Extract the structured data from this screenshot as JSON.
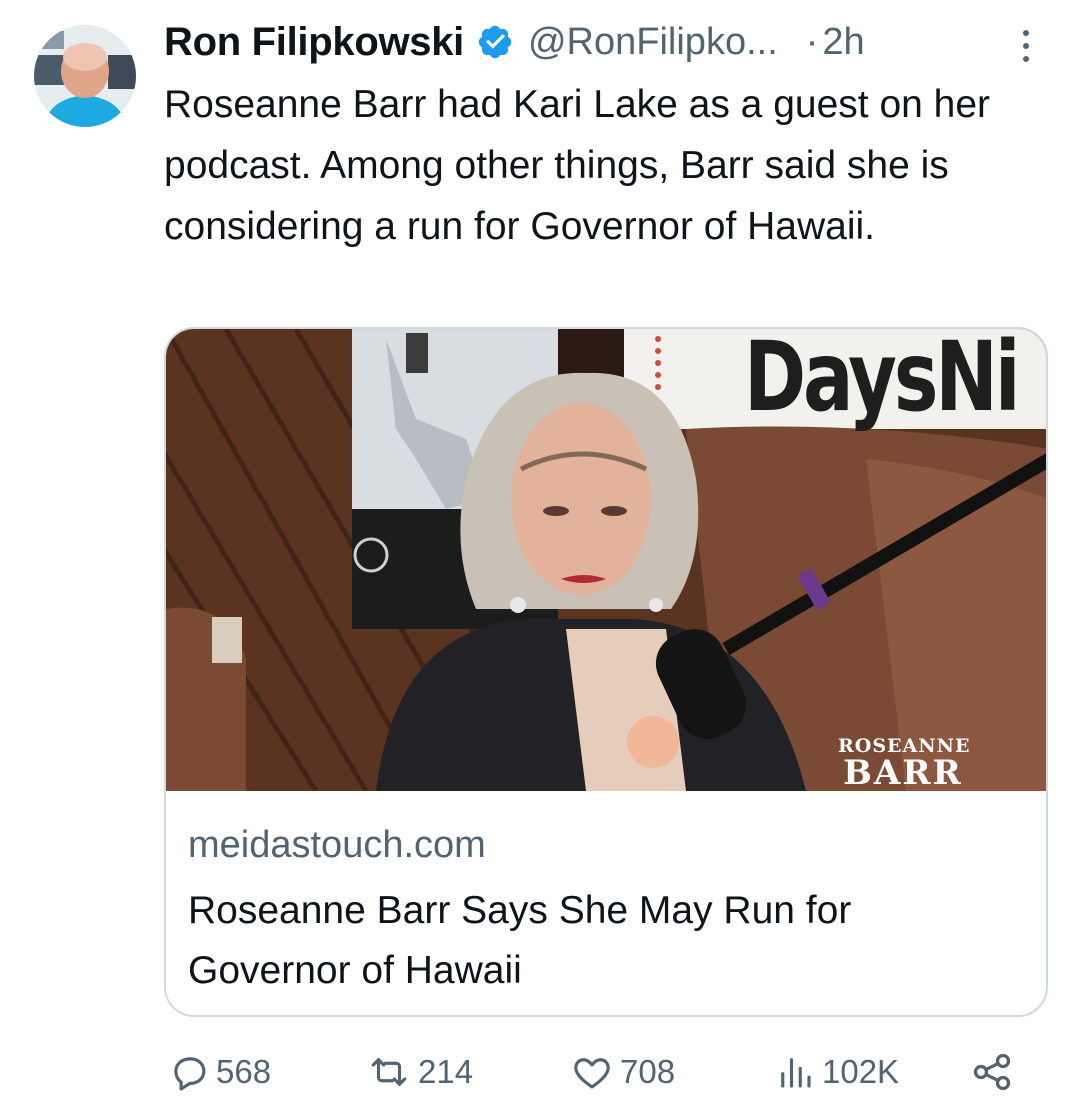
{
  "author": {
    "display_name": "Ron Filipkowski",
    "handle": "@RonFilipko...",
    "separator": "·",
    "time": "2h"
  },
  "tweet": {
    "text": "Roseanne Barr had Kari Lake as a guest on her podcast. Among other things, Barr said she is considering a run for Governor of Hawaii."
  },
  "card": {
    "domain": "meidastouch.com",
    "title": "Roseanne Barr Says She May Run for Governor of Hawaii",
    "image_watermark_top": "ROSEANNE",
    "image_watermark_bottom": "BARR",
    "image_sign_text": "DaysNi"
  },
  "actions": {
    "replies": "568",
    "reposts": "214",
    "likes": "708",
    "views": "102K"
  },
  "icons": {
    "verified": "verified-badge-icon",
    "reply": "reply-icon",
    "repost": "repost-icon",
    "like": "heart-icon",
    "views": "views-chart-icon",
    "share": "share-icon",
    "more": "more-vertical-icon"
  },
  "colors": {
    "verified": "#1d9bf0",
    "text": "#0f1419",
    "secondary": "#536471",
    "border": "#cfd9de"
  }
}
